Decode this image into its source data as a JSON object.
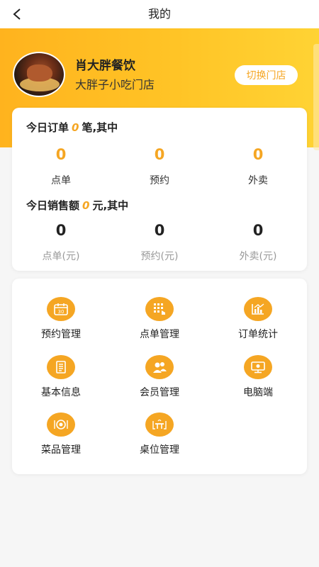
{
  "nav": {
    "title": "我的"
  },
  "store": {
    "name": "肖大胖餐饮",
    "branch": "大胖子小吃门店",
    "switch_label": "切换门店"
  },
  "orders": {
    "prefix": "今日订单",
    "count": "0",
    "suffix": "笔,其中",
    "items": [
      {
        "value": "0",
        "label": "点单"
      },
      {
        "value": "0",
        "label": "预约"
      },
      {
        "value": "0",
        "label": "外卖"
      }
    ]
  },
  "sales": {
    "prefix": "今日销售额",
    "amount": "0",
    "suffix": "元,其中",
    "items": [
      {
        "value": "0",
        "label": "点单(元)"
      },
      {
        "value": "0",
        "label": "预约(元)"
      },
      {
        "value": "0",
        "label": "外卖(元)"
      }
    ]
  },
  "menu": [
    {
      "label": "预约管理",
      "icon": "calendar-icon"
    },
    {
      "label": "点单管理",
      "icon": "keypad-icon"
    },
    {
      "label": "订单统计",
      "icon": "chart-icon"
    },
    {
      "label": "基本信息",
      "icon": "document-icon"
    },
    {
      "label": "会员管理",
      "icon": "members-icon"
    },
    {
      "label": "电脑端",
      "icon": "monitor-icon"
    },
    {
      "label": "菜品管理",
      "icon": "dish-icon"
    },
    {
      "label": "桌位管理",
      "icon": "table-icon"
    }
  ],
  "colors": {
    "accent": "#f5a623",
    "banner_start": "#ffb31e",
    "banner_end": "#ffd334"
  }
}
